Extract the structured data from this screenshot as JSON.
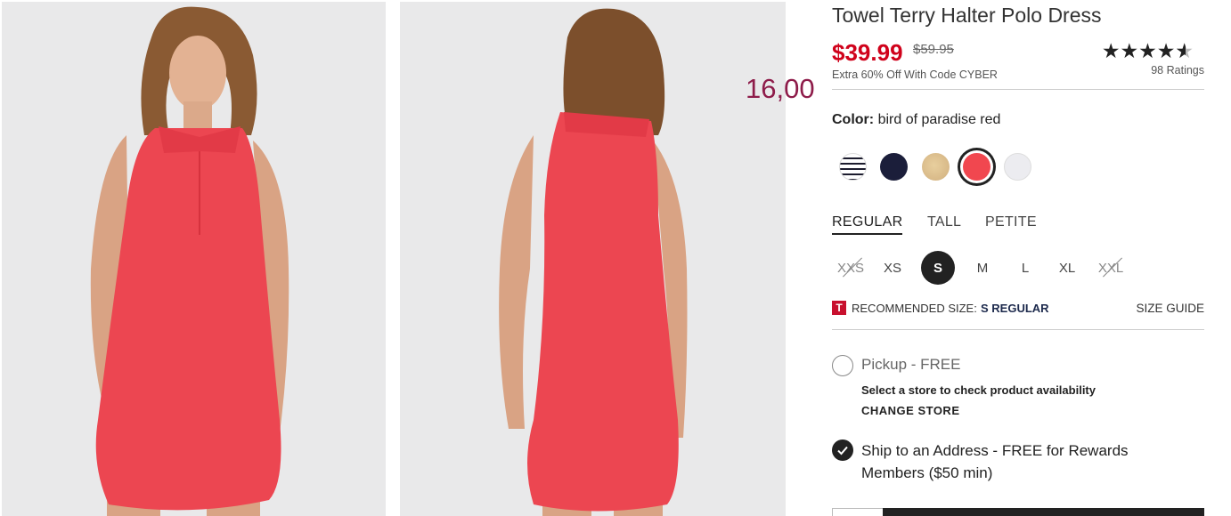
{
  "product": {
    "title": "Towel Terry Halter Polo Dress",
    "price": "$39.99",
    "original_price": "$59.95",
    "promo": "Extra 60% Off With Code CYBER",
    "rating_count": "98 Ratings",
    "rating_value": 4.5
  },
  "overlay": {
    "number": "16,00"
  },
  "color": {
    "label": "Color:",
    "value": "bird of paradise red",
    "swatches": [
      {
        "name": "stripe",
        "hex": "#1c1c2e"
      },
      {
        "name": "navy",
        "hex": "#1b1e3a"
      },
      {
        "name": "tan",
        "hex": "#d8b988"
      },
      {
        "name": "bird of paradise red",
        "hex": "#f1474f",
        "selected": true
      },
      {
        "name": "white",
        "hex": "#ececf0"
      }
    ]
  },
  "fits": [
    "REGULAR",
    "TALL",
    "PETITE"
  ],
  "sizes": [
    {
      "label": "XXS",
      "available": false
    },
    {
      "label": "XS",
      "available": true
    },
    {
      "label": "S",
      "available": true,
      "selected": true
    },
    {
      "label": "M",
      "available": true
    },
    {
      "label": "L",
      "available": true
    },
    {
      "label": "XL",
      "available": true
    },
    {
      "label": "XXL",
      "available": false
    }
  ],
  "recommendation": {
    "icon": "T",
    "label": "RECOMMENDED SIZE:",
    "value": "S REGULAR",
    "size_guide": "SIZE GUIDE"
  },
  "fulfillment": {
    "pickup_label": "Pickup - FREE",
    "store_message": "Select a store to check product availability",
    "change_store": "CHANGE STORE",
    "ship_label": "Ship to an Address - FREE for Rewards Members ($50 min)"
  },
  "colors": {
    "price_red": "#d0021b",
    "overlay_num": "#8e1c4a",
    "dress": "#ec4651"
  }
}
